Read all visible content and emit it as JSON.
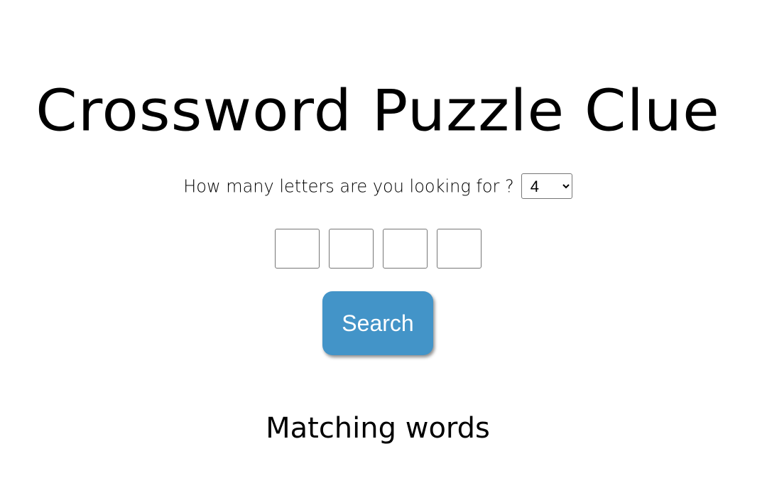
{
  "header": {
    "title": "Crossword Puzzle Clue"
  },
  "form": {
    "letters_question": "How many letters are you looking for ?",
    "letter_count_selected": "4",
    "letter_count_options": [
      "4"
    ],
    "letter_boxes": [
      "",
      "",
      "",
      ""
    ],
    "search_label": "Search"
  },
  "results": {
    "heading": "Matching words"
  },
  "colors": {
    "search_button_bg": "#4394c8",
    "search_button_text": "#ffffff"
  }
}
